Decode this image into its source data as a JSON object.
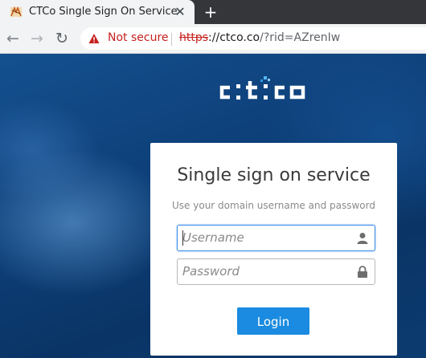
{
  "browser": {
    "tab": {
      "title": "CTCo Single Sign On Service",
      "favicon": "ctco-favicon-icon"
    },
    "omnibox": {
      "security_label": "Not secure",
      "url_scheme": "https",
      "url_rest": "://ctco.co",
      "url_path": "/?rid=AZrenIw"
    },
    "colors": {
      "warning": "#c5221f"
    }
  },
  "page": {
    "logo_text": "c:t:co",
    "card": {
      "title": "Single sign on service",
      "subtitle": "Use your domain username and password",
      "username_placeholder": "Username",
      "password_placeholder": "Password",
      "login_label": "Login"
    },
    "colors": {
      "accent": "#1a8be0",
      "focus": "#3a8ee6"
    }
  }
}
